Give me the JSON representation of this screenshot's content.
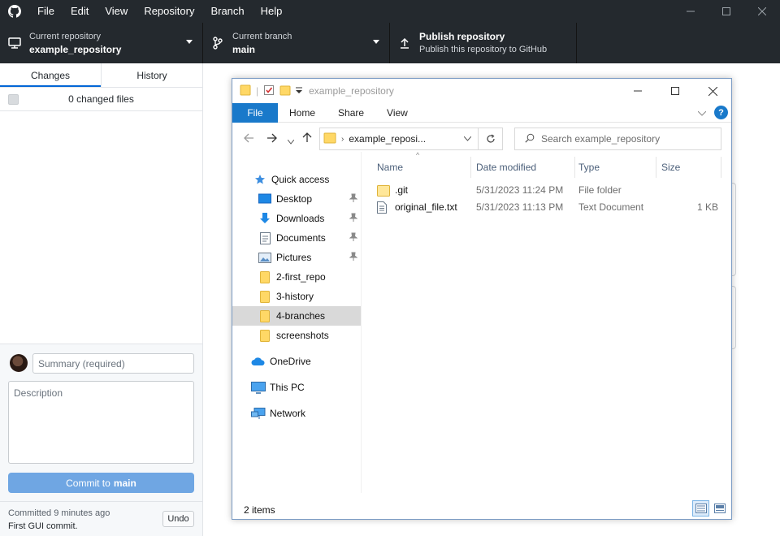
{
  "github_desktop": {
    "menu": [
      "File",
      "Edit",
      "View",
      "Repository",
      "Branch",
      "Help"
    ],
    "toolbar": {
      "repo_label": "Current repository",
      "repo_value": "example_repository",
      "branch_label": "Current branch",
      "branch_value": "main",
      "publish_title": "Publish repository",
      "publish_subtitle": "Publish this repository to GitHub"
    },
    "tabs": {
      "changes": "Changes",
      "history": "History"
    },
    "changed_files": "0 changed files",
    "commit": {
      "summary_placeholder": "Summary (required)",
      "description_placeholder": "Description",
      "button_prefix": "Commit to",
      "button_branch": "main"
    },
    "last_commit": {
      "time": "Committed 9 minutes ago",
      "message": "First GUI commit.",
      "undo_label": "Undo"
    }
  },
  "explorer": {
    "title": "example_repository",
    "ribbon_tabs": [
      "File",
      "Home",
      "Share",
      "View"
    ],
    "address": "example_reposi...",
    "search_placeholder": "Search example_repository",
    "nav": {
      "quick_access": "Quick access",
      "pinned": [
        "Desktop",
        "Downloads",
        "Documents",
        "Pictures"
      ],
      "folders": [
        "2-first_repo",
        "3-history",
        "4-branches",
        "screenshots"
      ],
      "selected": "4-branches",
      "onedrive": "OneDrive",
      "this_pc": "This PC",
      "network": "Network"
    },
    "columns": [
      "Name",
      "Date modified",
      "Type",
      "Size"
    ],
    "files": [
      {
        "name": ".git",
        "date": "5/31/2023 11:24 PM",
        "type": "File folder",
        "size": "",
        "icon": "folder-icon"
      },
      {
        "name": "original_file.txt",
        "date": "5/31/2023 11:13 PM",
        "type": "Text Document",
        "size": "1 KB",
        "icon": "text-file-icon"
      }
    ],
    "status": "2 items"
  }
}
